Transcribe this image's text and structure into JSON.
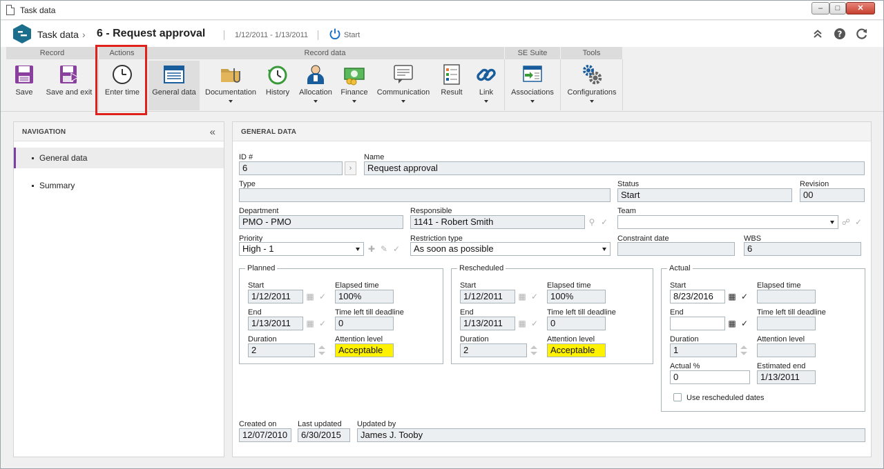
{
  "window": {
    "title": "Task data"
  },
  "header": {
    "module": "Task data",
    "record_title": "6 - Request approval",
    "date_range": "1/12/2011 - 1/13/2011",
    "action_label": "Start"
  },
  "ribbon": {
    "groups": [
      "Record",
      "Actions",
      "Record data",
      "SE Suite",
      "Tools"
    ],
    "buttons": {
      "save": "Save",
      "save_exit": "Save and exit",
      "enter_time": "Enter time",
      "general_data": "General data",
      "documentation": "Documentation",
      "history": "History",
      "allocation": "Allocation",
      "finance": "Finance",
      "communication": "Communication",
      "result": "Result",
      "link": "Link",
      "associations": "Associations",
      "configurations": "Configurations"
    }
  },
  "navigation": {
    "title": "NAVIGATION",
    "items": [
      "General data",
      "Summary"
    ]
  },
  "general": {
    "title": "GENERAL DATA",
    "labels": {
      "id": "ID #",
      "name": "Name",
      "type": "Type",
      "status": "Status",
      "revision": "Revision",
      "department": "Department",
      "responsible": "Responsible",
      "team": "Team",
      "priority": "Priority",
      "restriction": "Restriction type",
      "constraint": "Constraint date",
      "wbs": "WBS",
      "start": "Start",
      "end": "End",
      "duration": "Duration",
      "elapsed": "Elapsed time",
      "time_left": "Time left till deadline",
      "attention": "Attention level",
      "actual_pct": "Actual %",
      "est_end": "Estimated end",
      "use_resched": "Use rescheduled dates",
      "created_on": "Created on",
      "last_updated": "Last updated",
      "updated_by": "Updated by"
    },
    "values": {
      "id": "6",
      "name": "Request approval",
      "type": "",
      "status": "Start",
      "revision": "00",
      "department": "PMO - PMO",
      "responsible": "1141 - Robert Smith",
      "team": "",
      "priority": "High - 1",
      "restriction": "As soon as possible",
      "constraint": "",
      "wbs": "6",
      "created_on": "12/07/2010",
      "last_updated": "6/30/2015",
      "updated_by": "James J. Tooby"
    },
    "planned": {
      "legend": "Planned",
      "start": "1/12/2011",
      "end": "1/13/2011",
      "duration": "2",
      "elapsed": "100%",
      "time_left": "0",
      "attention": "Acceptable"
    },
    "rescheduled": {
      "legend": "Rescheduled",
      "start": "1/12/2011",
      "end": "1/13/2011",
      "duration": "2",
      "elapsed": "100%",
      "time_left": "0",
      "attention": "Acceptable"
    },
    "actual": {
      "legend": "Actual",
      "start": "8/23/2016",
      "end": "",
      "duration": "1",
      "elapsed": "",
      "time_left": "",
      "attention": "",
      "actual_pct": "0",
      "est_end": "1/13/2011"
    }
  },
  "colors": {
    "accent": "#7b3fa0",
    "highlight": "#e0201a",
    "attention_ok": "#fff200",
    "logo": "#1c6f8c"
  }
}
